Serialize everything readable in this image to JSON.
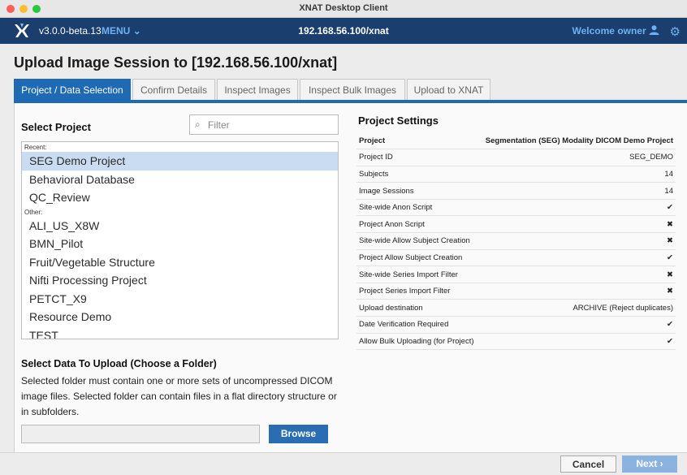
{
  "window": {
    "title": "XNAT Desktop Client"
  },
  "header": {
    "version": "v3.0.0-beta.13",
    "menu_label": "MENU",
    "host": "192.168.56.100/xnat",
    "welcome": "Welcome owner"
  },
  "page": {
    "title": "Upload Image Session to [192.168.56.100/xnat]"
  },
  "tabs": [
    {
      "label": "Project / Data Selection"
    },
    {
      "label": "Confirm Details"
    },
    {
      "label": "Inspect Images"
    },
    {
      "label": "Inspect Bulk Images"
    },
    {
      "label": "Upload to XNAT"
    }
  ],
  "select_project": {
    "heading": "Select Project",
    "filter_placeholder": "Filter",
    "recent_label": "Recent:",
    "recent": [
      "SEG Demo Project",
      "Behavioral Database",
      "QC_Review"
    ],
    "other_label": "Other:",
    "other": [
      "ALI_US_X8W",
      "BMN_Pilot",
      "Fruit/Vegetable Structure",
      "Nifti Processing Project",
      "PETCT_X9",
      "Resource Demo",
      "TEST"
    ]
  },
  "select_data": {
    "heading": "Select Data To Upload (Choose a Folder)",
    "description": "Selected folder must contain one or more sets of uncompressed DICOM image files. Selected folder can contain files in a flat directory structure or in subfolders.",
    "browse_label": "Browse"
  },
  "project_settings": {
    "heading": "Project Settings",
    "header_label": "Project",
    "header_value": "Segmentation (SEG) Modality DICOM Demo Project",
    "rows": [
      {
        "label": "Project ID",
        "value": "SEG_DEMO"
      },
      {
        "label": "Subjects",
        "value": "14"
      },
      {
        "label": "Image Sessions",
        "value": "14"
      },
      {
        "label": "Site-wide Anon Script",
        "value": "✔"
      },
      {
        "label": "Project Anon Script",
        "value": "✖"
      },
      {
        "label": "Site-wide Allow Subject Creation",
        "value": "✖"
      },
      {
        "label": "Project Allow Subject Creation",
        "value": "✔"
      },
      {
        "label": "Site-wide Series Import Filter",
        "value": "✖"
      },
      {
        "label": "Project Series Import Filter",
        "value": "✖"
      },
      {
        "label": "Upload destination",
        "value": "ARCHIVE (Reject duplicates)"
      },
      {
        "label": "Date Verification Required",
        "value": "✔"
      },
      {
        "label": "Allow Bulk Uploading (for Project)",
        "value": "✔"
      }
    ]
  },
  "footer": {
    "cancel_label": "Cancel",
    "next_label": "Next ›"
  }
}
